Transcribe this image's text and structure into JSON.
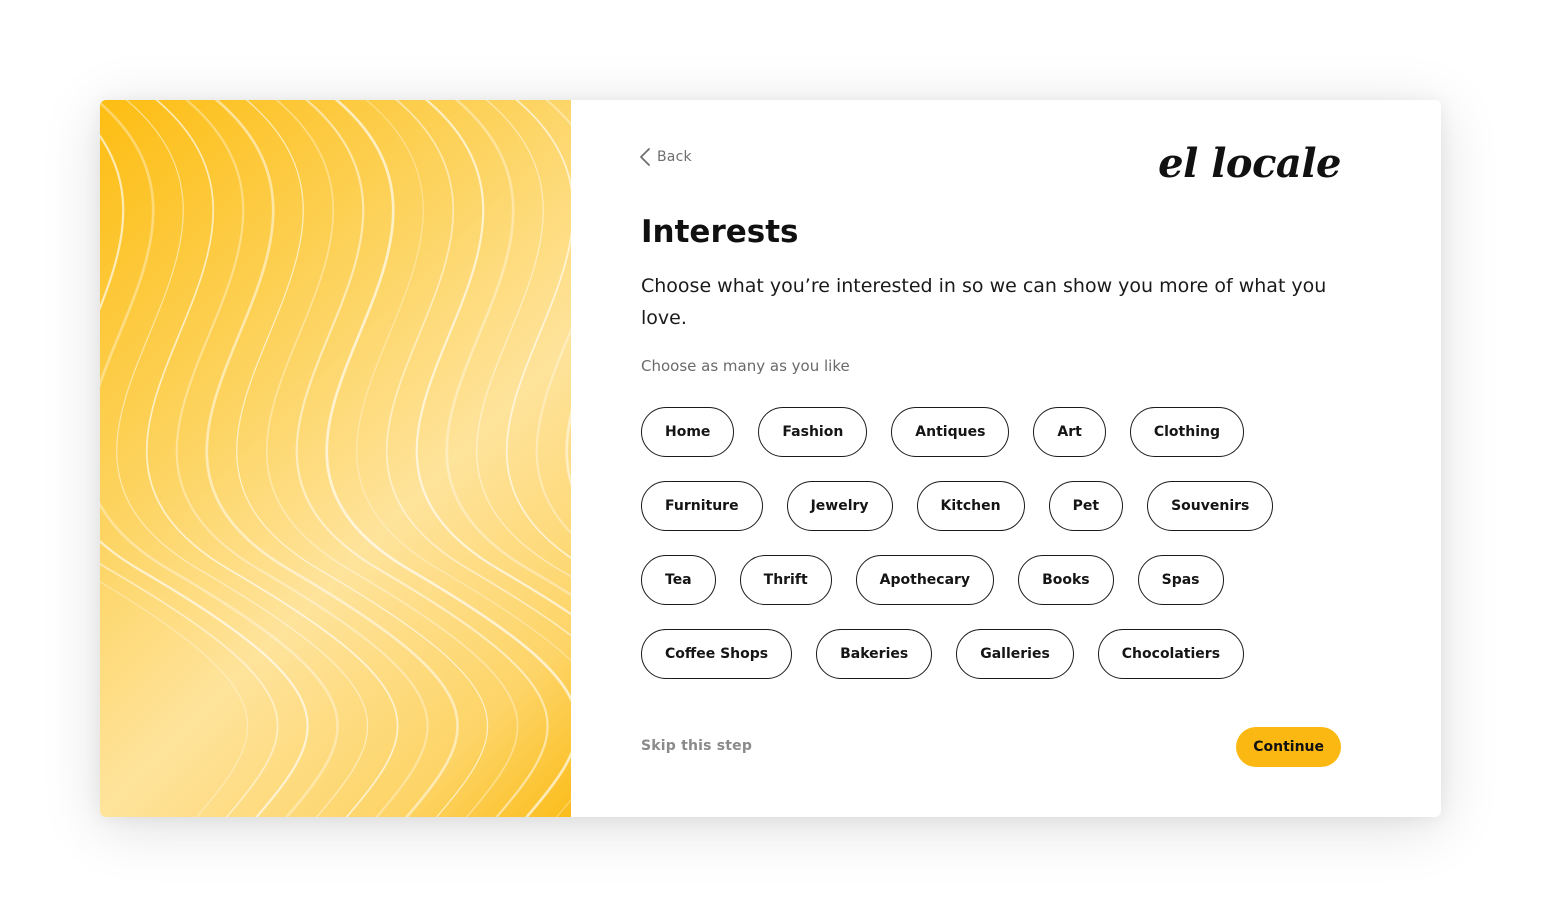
{
  "back": {
    "label": "Back"
  },
  "brand": {
    "logo_text": "el locale"
  },
  "page": {
    "title": "Interests",
    "subtitle": "Choose what you’re interested in so we can show you more of what you love.",
    "hint": "Choose as many as you like"
  },
  "interests": {
    "rows": [
      [
        "Home",
        "Fashion",
        "Antiques",
        "Art",
        "Clothing"
      ],
      [
        "Furniture",
        "Jewelry",
        "Kitchen",
        "Pet",
        "Souvenirs"
      ],
      [
        "Tea",
        "Thrift",
        "Apothecary",
        "Books",
        "Spas"
      ],
      [
        "Coffee Shops",
        "Bakeries",
        "Galleries",
        "Chocolatiers"
      ]
    ]
  },
  "footer": {
    "skip_label": "Skip this step",
    "continue_label": "Continue"
  },
  "colors": {
    "accent": "#fbb812",
    "art_gradient": [
      "#fdbd12",
      "#fee39b",
      "#fbbd1b"
    ],
    "chip_border": "#1b1b1b"
  },
  "icons": {
    "back": "chevron-left-icon"
  }
}
